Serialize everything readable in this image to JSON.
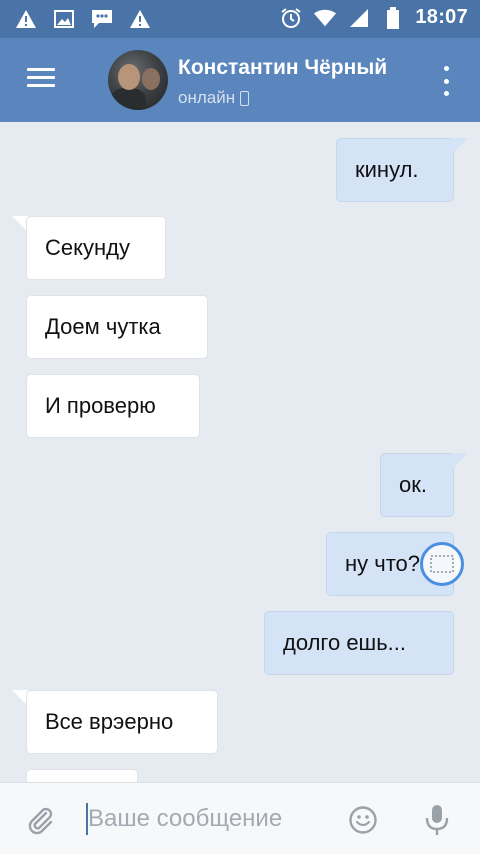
{
  "status_bar": {
    "time": "18:07",
    "icons": [
      "warning-icon",
      "image-icon",
      "message-icon",
      "warning-icon",
      "alarm-icon",
      "wifi-icon",
      "signal-icon",
      "battery-icon"
    ]
  },
  "header": {
    "menu_icon": "menu-icon",
    "name": "Константин Чёрный",
    "status": "онлайн",
    "status_icon": "phone-icon",
    "more_icon": "more-icon"
  },
  "messages": [
    {
      "direction": "out",
      "text": "кинул."
    },
    {
      "direction": "in",
      "text": "Секунду"
    },
    {
      "direction": "in",
      "text": "Доем чутка"
    },
    {
      "direction": "in",
      "text": "И проверю"
    },
    {
      "direction": "out",
      "text": "ок."
    },
    {
      "direction": "out",
      "text": "ну что?"
    },
    {
      "direction": "out",
      "text": "долго ешь..."
    },
    {
      "direction": "in",
      "text": "Все врэерно"
    },
    {
      "direction": "in",
      "text": ""
    }
  ],
  "input": {
    "placeholder": "Ваше сообщение",
    "value": ""
  },
  "colors": {
    "status_bar": "#4a73a8",
    "header": "#5b85bd",
    "background": "#e6ebf2",
    "bubble_in": "#ffffff",
    "bubble_out": "#d4e3f6"
  }
}
